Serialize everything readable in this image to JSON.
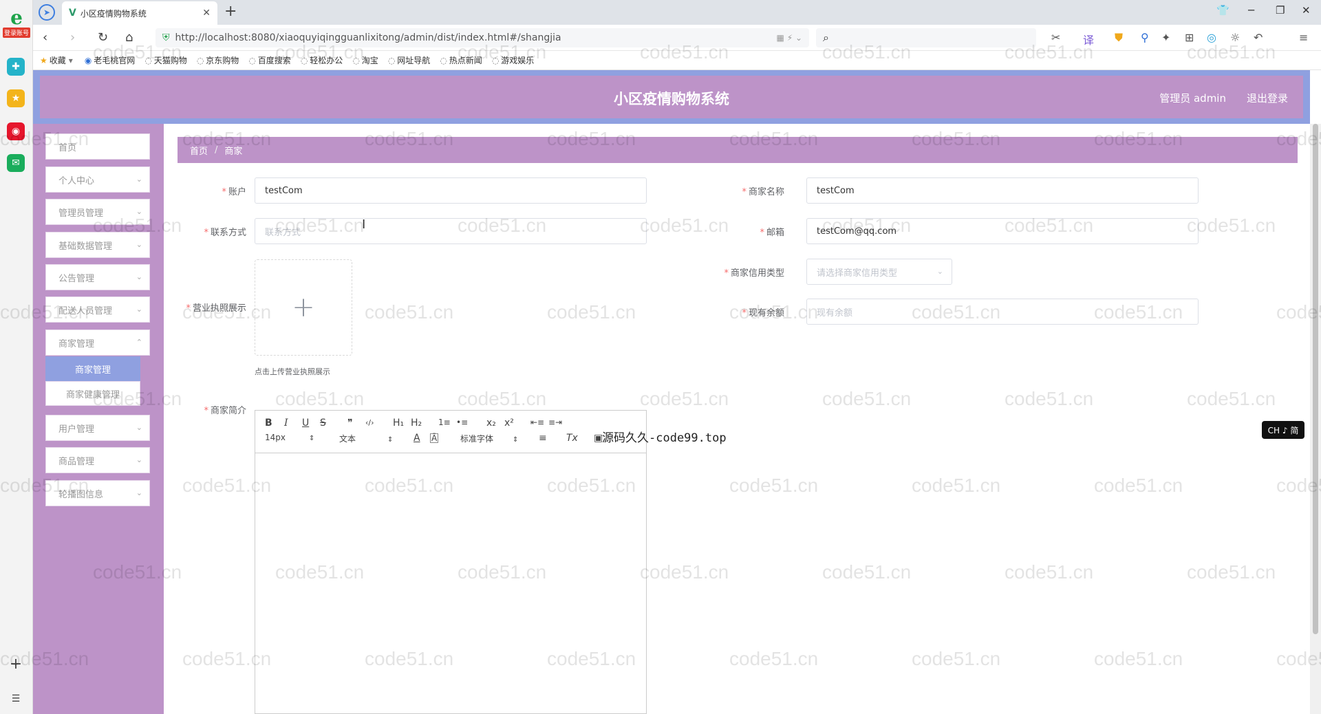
{
  "browser": {
    "rail": {
      "login_badge": "登录账号"
    },
    "tab": {
      "title": "小区疫情购物系统"
    },
    "url": "http://localhost:8080/xiaoquyiqingguanlixitong/admin/dist/index.html#/shangjia",
    "bookmarks": [
      "收藏",
      "老毛桃官网",
      "天猫购物",
      "京东购物",
      "百度搜索",
      "轻松办公",
      "淘宝",
      "网址导航",
      "热点新闻",
      "游戏娱乐"
    ],
    "ime": "CH ♪ 简"
  },
  "app": {
    "title": "小区疫情购物系统",
    "user": "管理员 admin",
    "logout": "退出登录"
  },
  "sidebar": {
    "items": [
      {
        "label": "首页",
        "has_children": false
      },
      {
        "label": "个人中心",
        "has_children": true
      },
      {
        "label": "管理员管理",
        "has_children": true
      },
      {
        "label": "基础数据管理",
        "has_children": true
      },
      {
        "label": "公告管理",
        "has_children": true
      },
      {
        "label": "配送人员管理",
        "has_children": true
      },
      {
        "label": "商家管理",
        "has_children": true,
        "expanded": true
      },
      {
        "label": "用户管理",
        "has_children": true
      },
      {
        "label": "商品管理",
        "has_children": true
      },
      {
        "label": "轮播图信息",
        "has_children": true
      }
    ],
    "sub_items": [
      {
        "label": "商家管理",
        "active": true
      },
      {
        "label": "商家健康管理",
        "active": false
      }
    ]
  },
  "breadcrumb": {
    "home": "首页",
    "sep": "/",
    "current": "商家"
  },
  "form": {
    "account": {
      "label": "账户",
      "value": "testCom"
    },
    "shop_name": {
      "label": "商家名称",
      "value": "testCom"
    },
    "contact": {
      "label": "联系方式",
      "placeholder": "联系方式"
    },
    "email": {
      "label": "邮箱",
      "value": "testCom@qq.com"
    },
    "license": {
      "label": "营业执照展示",
      "tip": "点击上传营业执照展示"
    },
    "credit_type": {
      "label": "商家信用类型",
      "placeholder": "请选择商家信用类型"
    },
    "balance": {
      "label": "现有余额",
      "placeholder": "现有余额"
    },
    "intro": {
      "label": "商家简介"
    }
  },
  "editor": {
    "font_size": "14px",
    "paragraph": "文本",
    "font_family": "标准字体",
    "buttons": [
      "B",
      "I",
      "U",
      "S",
      "❞",
      "‹/›",
      "H₁",
      "H₂",
      "1≡",
      "•≡",
      "x₂",
      "x²",
      "⇤≡",
      "≡⇥",
      "A",
      "Ā",
      "≡",
      "Tx",
      "▣"
    ]
  },
  "overlay_text": "源码久久-code99.top",
  "watermark": "code51.cn"
}
